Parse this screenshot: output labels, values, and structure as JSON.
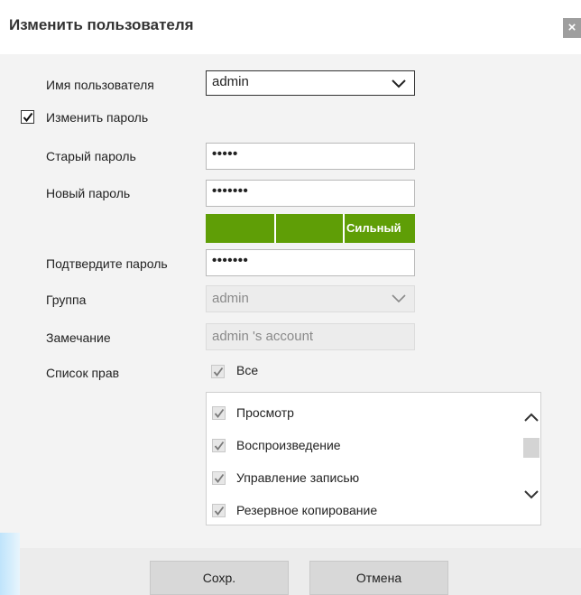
{
  "dialog": {
    "title": "Изменить пользователя",
    "close_glyph": "×"
  },
  "form": {
    "username": {
      "label": "Имя пользователя",
      "value": "admin"
    },
    "change_password": {
      "label": "Изменить пароль",
      "checked": true
    },
    "old_password": {
      "label": "Старый пароль",
      "value": "•••••"
    },
    "new_password": {
      "label": "Новый пароль",
      "value": "•••••••"
    },
    "strength": {
      "label": "Сильный",
      "level": 1.0,
      "color": "#5f9e06"
    },
    "confirm_password": {
      "label": "Подтвердите пароль",
      "value": "•••••••"
    },
    "group": {
      "label": "Группа",
      "value": "admin"
    },
    "note": {
      "label": "Замечание",
      "value": "admin 's account"
    },
    "rights": {
      "label": "Список прав",
      "all_label": "Все",
      "items": [
        "Просмотр",
        "Воспроизведение",
        "Управление записью",
        "Резервное копирование"
      ]
    }
  },
  "buttons": {
    "save": "Сохр.",
    "cancel": "Отмена"
  },
  "icons": {
    "checkbox": "check-icon",
    "dropdown": "chevron-down-icon",
    "scroll_up": "chevron-up-icon",
    "scroll_down": "chevron-down-icon"
  }
}
